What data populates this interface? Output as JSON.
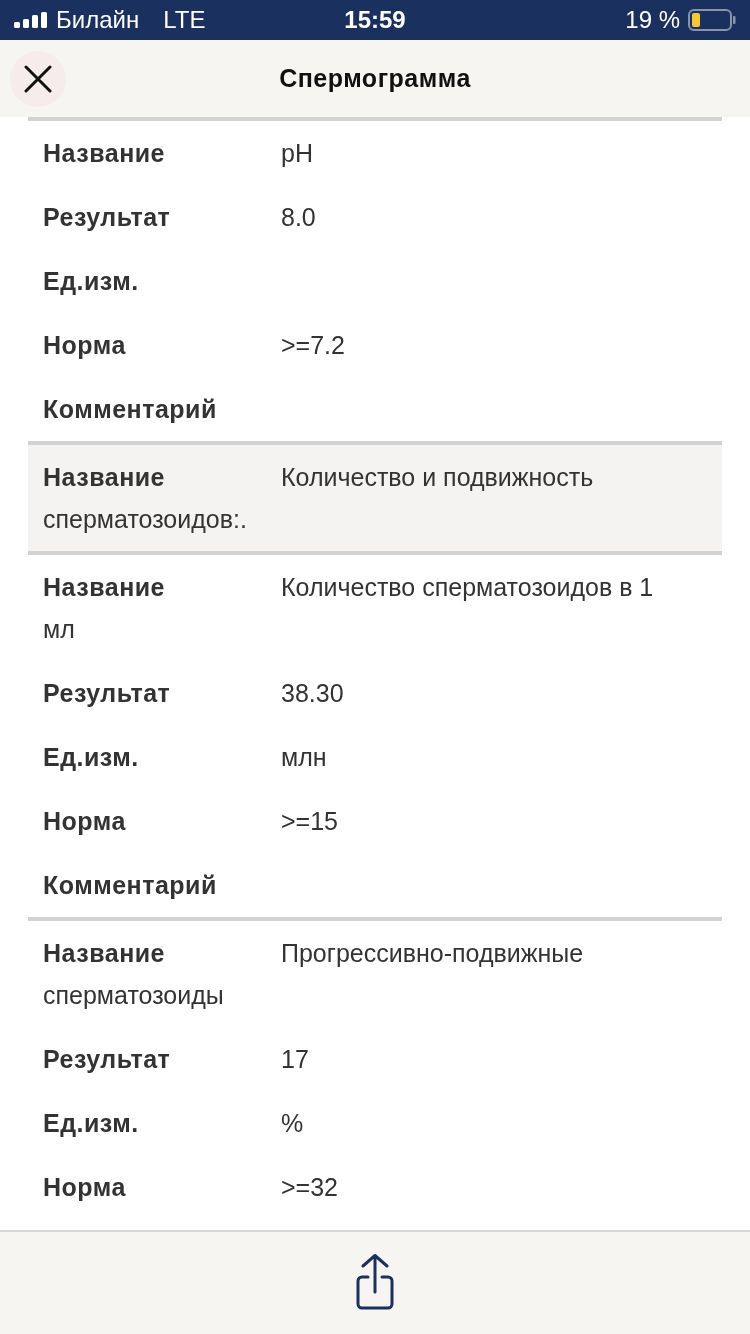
{
  "status_bar": {
    "carrier": "Билайн",
    "network": "LTE",
    "time": "15:59",
    "battery": "19 %"
  },
  "header": {
    "title": "Спермограмма"
  },
  "sections": [
    {
      "kind": "item",
      "rows": [
        {
          "label": "Название",
          "value": "pH"
        },
        {
          "label": "Результат",
          "value": "8.0"
        },
        {
          "label": "Ед.изм."
        },
        {
          "label": "Норма",
          "value": ">=7.2"
        },
        {
          "label": "Комментарий"
        }
      ]
    },
    {
      "kind": "group",
      "rows": [
        {
          "label": "Название",
          "value": "Количество и подвижность",
          "value_cont": "сперматозоидов:."
        }
      ]
    },
    {
      "kind": "item",
      "rows": [
        {
          "label": "Название",
          "value": "Количество сперматозоидов в 1",
          "value_cont": "мл"
        },
        {
          "label": "Результат",
          "value": "38.30"
        },
        {
          "label": "Ед.изм.",
          "value": "млн"
        },
        {
          "label": "Норма",
          "value": ">=15"
        },
        {
          "label": "Комментарий"
        }
      ]
    },
    {
      "kind": "item",
      "rows": [
        {
          "label": "Название",
          "value": "Прогрессивно-подвижные",
          "value_cont": "сперматозоиды"
        },
        {
          "label": "Результат",
          "value": "17"
        },
        {
          "label": "Ед.изм.",
          "value": "%"
        },
        {
          "label": "Норма",
          "value": ">=32"
        }
      ]
    }
  ]
}
